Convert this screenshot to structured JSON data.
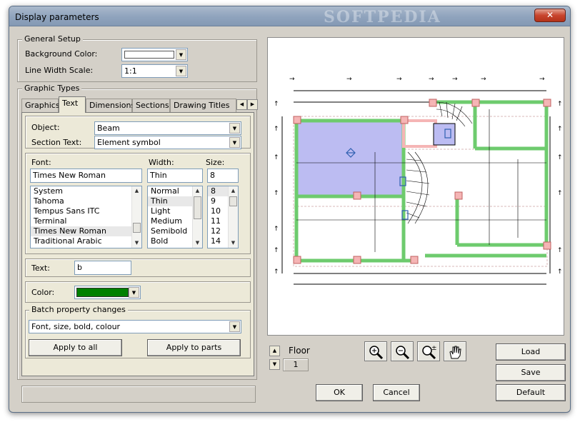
{
  "window": {
    "title": "Display parameters",
    "watermark": "SOFTPEDIA",
    "close_glyph": "✕"
  },
  "general_setup": {
    "legend": "General Setup",
    "background_color_label": "Background Color:",
    "background_color_value": "#ffffff",
    "line_width_label": "Line Width Scale:",
    "line_width_value": "1:1"
  },
  "graphic_types": {
    "legend": "Graphic Types",
    "tabs": [
      {
        "label": "Graphics"
      },
      {
        "label": "Text"
      },
      {
        "label": "Dimensions"
      },
      {
        "label": "Sections"
      },
      {
        "label": "Drawing Titles"
      }
    ],
    "active_tab": "Text",
    "object_label": "Object:",
    "object_value": "Beam",
    "section_text_label": "Section Text:",
    "section_text_value": "Element symbol",
    "font_label": "Font:",
    "font_value": "Times New Roman",
    "font_list": [
      "System",
      "Tahoma",
      "Tempus Sans ITC",
      "Terminal",
      "Times New Roman",
      "Traditional Arabic"
    ],
    "font_selected": "Times New Roman",
    "width_label": "Width:",
    "width_value": "Thin",
    "width_list": [
      "Normal",
      "Thin",
      "Light",
      "Medium",
      "Semibold",
      "Bold"
    ],
    "width_selected": "Thin",
    "size_label": "Size:",
    "size_value": "8",
    "size_list": [
      "8",
      "9",
      "10",
      "11",
      "12",
      "14"
    ],
    "size_selected": "8",
    "text_label": "Text:",
    "text_value": "b",
    "color_label": "Color:",
    "color_value": "#008000",
    "batch_legend": "Batch property changes",
    "batch_value": "Font, size, bold, colour",
    "apply_all_label": "Apply to all",
    "apply_parts_label": "Apply to parts"
  },
  "floor": {
    "label": "Floor",
    "value": "1"
  },
  "zoom_tools": [
    {
      "name": "zoom-in-icon"
    },
    {
      "name": "zoom-out-icon"
    },
    {
      "name": "zoom-fit-icon"
    },
    {
      "name": "pan-hand-icon"
    }
  ],
  "buttons": {
    "load": "Load",
    "save": "Save",
    "default": "Default",
    "ok": "OK",
    "cancel": "Cancel"
  },
  "colors": {
    "slab_fill": "#bcbcf2",
    "wall_green": "#6ecb6e",
    "column_pink": "#f5b5b5",
    "accent_blue": "#2f5fb0"
  }
}
